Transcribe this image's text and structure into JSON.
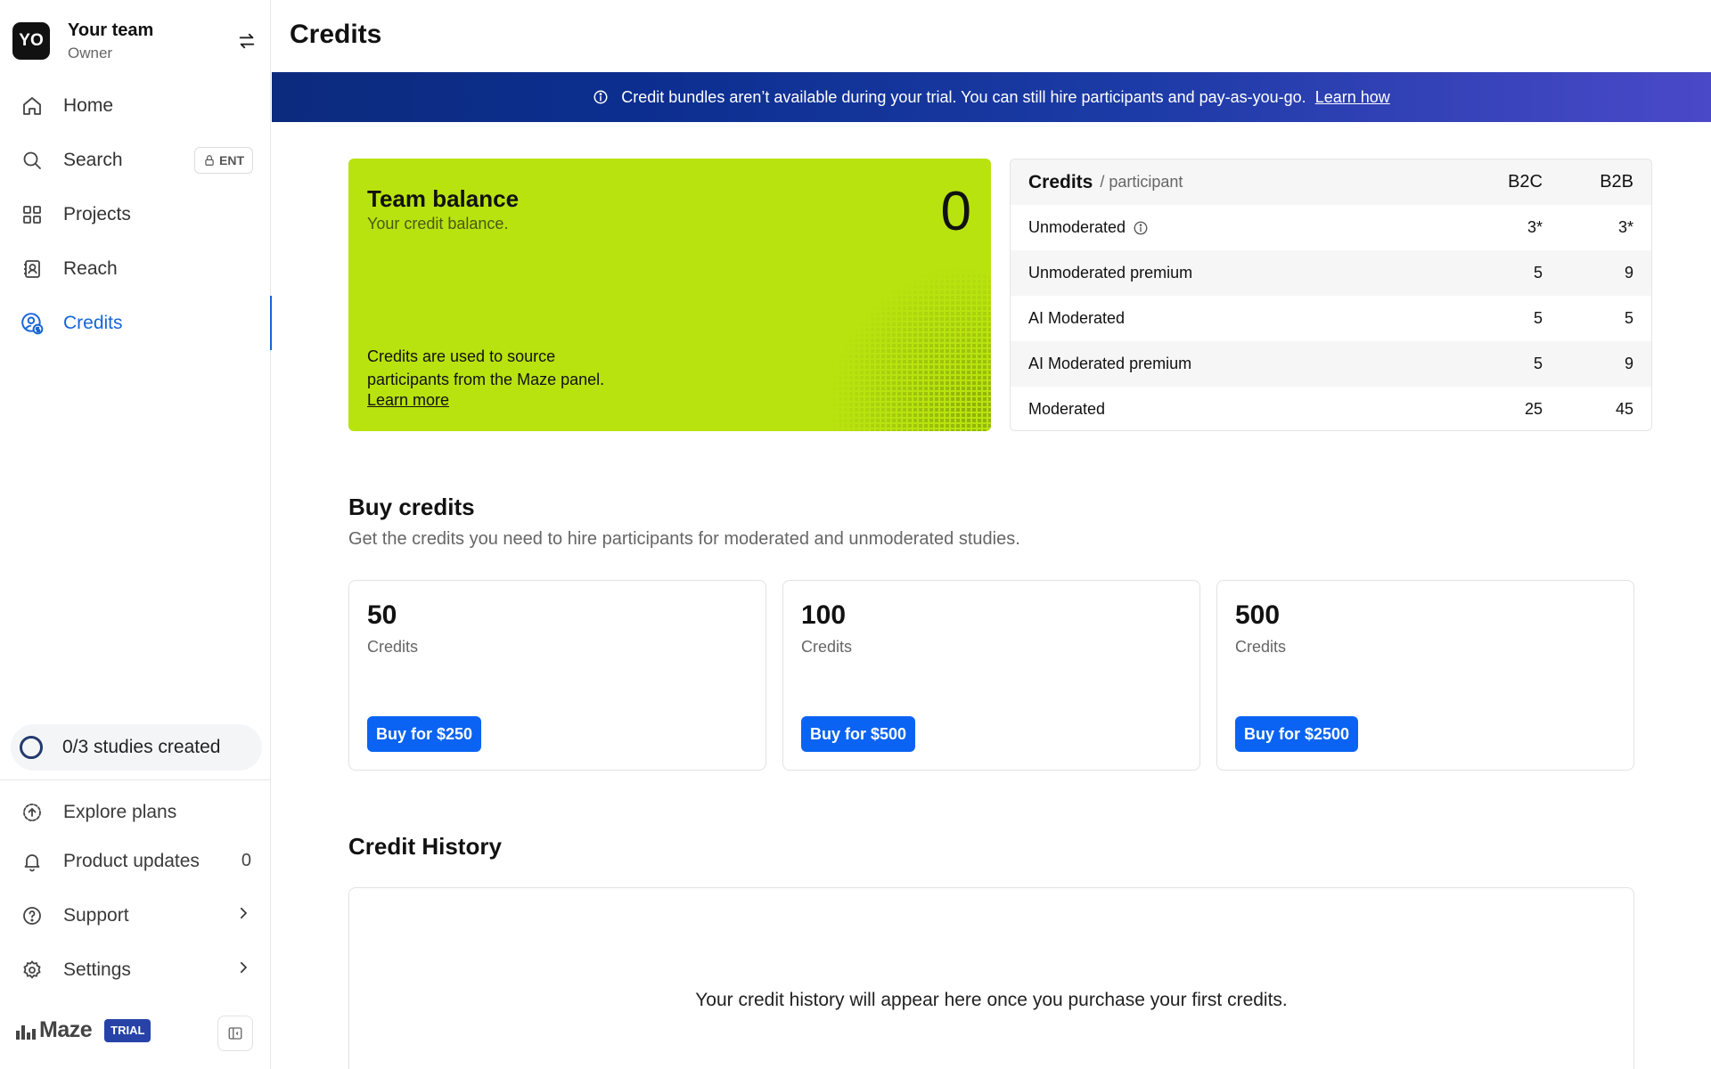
{
  "team": {
    "initials": "YO",
    "name": "Your team",
    "role": "Owner"
  },
  "nav": {
    "home": "Home",
    "search": "Search",
    "search_badge": "ENT",
    "projects": "Projects",
    "reach": "Reach",
    "credits": "Credits"
  },
  "studies": {
    "label": "0/3 studies created"
  },
  "bottom_nav": {
    "explore": "Explore plans",
    "updates": "Product updates",
    "updates_count": "0",
    "support": "Support",
    "settings": "Settings"
  },
  "brand": {
    "name": "Maze",
    "badge": "TRIAL"
  },
  "page": {
    "title": "Credits"
  },
  "banner": {
    "text": "Credit bundles aren’t available during your trial. You can still hire participants and pay-as-you-go.",
    "link": "Learn how"
  },
  "balance": {
    "title": "Team balance",
    "subtitle": "Your credit balance.",
    "value": "0",
    "description": "Credits are used to source participants from the Maze panel.",
    "link": "Learn more"
  },
  "rates": {
    "header": {
      "title": "Credits",
      "suffix": "/ participant",
      "b2c": "B2C",
      "b2b": "B2B"
    },
    "rows": [
      {
        "name": "Unmoderated",
        "b2c": "3*",
        "b2b": "3*"
      },
      {
        "name": "Unmoderated premium",
        "b2c": "5",
        "b2b": "9"
      },
      {
        "name": "AI Moderated",
        "b2c": "5",
        "b2b": "5"
      },
      {
        "name": "AI Moderated premium",
        "b2c": "5",
        "b2b": "9"
      },
      {
        "name": "Moderated",
        "b2c": "25",
        "b2b": "45"
      }
    ]
  },
  "buy": {
    "title": "Buy credits",
    "subtitle": "Get the credits you need to hire participants for moderated and unmoderated studies.",
    "packs": [
      {
        "amount": "50",
        "unit": "Credits",
        "button": "Buy for $250"
      },
      {
        "amount": "100",
        "unit": "Credits",
        "button": "Buy for $500"
      },
      {
        "amount": "500",
        "unit": "Credits",
        "button": "Buy for $2500"
      }
    ]
  },
  "history": {
    "title": "Credit History",
    "empty": "Your credit history will appear here once you purchase your first credits."
  },
  "colors": {
    "accent": "#1565d8",
    "button": "#0a63f2",
    "balance_card": "#b9e30f",
    "banner": "#0c2b7e"
  }
}
